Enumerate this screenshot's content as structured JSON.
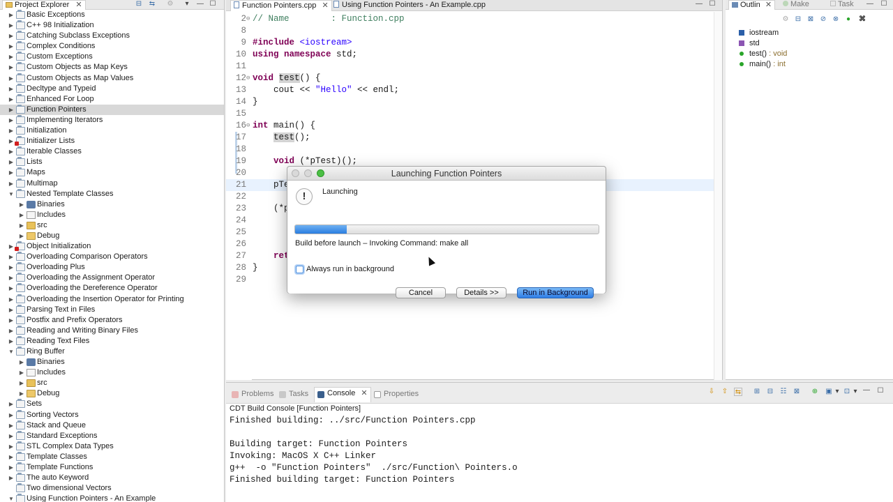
{
  "project_explorer": {
    "tab_label": "Project Explorer",
    "items": [
      {
        "label": "Basic Exceptions",
        "depth": 0,
        "expanded": false,
        "kind": "project",
        "error": false
      },
      {
        "label": "C++ 98 Initialization",
        "depth": 0,
        "expanded": false,
        "kind": "project",
        "error": false
      },
      {
        "label": "Catching Subclass Exceptions",
        "depth": 0,
        "expanded": false,
        "kind": "project",
        "error": false
      },
      {
        "label": "Complex Conditions",
        "depth": 0,
        "expanded": false,
        "kind": "project",
        "error": false
      },
      {
        "label": "Custom Exceptions",
        "depth": 0,
        "expanded": false,
        "kind": "project",
        "error": false
      },
      {
        "label": "Custom Objects as Map Keys",
        "depth": 0,
        "expanded": false,
        "kind": "project",
        "error": false
      },
      {
        "label": "Custom Objects as Map Values",
        "depth": 0,
        "expanded": false,
        "kind": "project",
        "error": false
      },
      {
        "label": "Decltype and Typeid",
        "depth": 0,
        "expanded": false,
        "kind": "project",
        "error": false
      },
      {
        "label": "Enhanced For Loop",
        "depth": 0,
        "expanded": false,
        "kind": "project",
        "error": false
      },
      {
        "label": "Function Pointers",
        "depth": 0,
        "expanded": false,
        "kind": "project",
        "error": false,
        "selected": true
      },
      {
        "label": "Implementing Iterators",
        "depth": 0,
        "expanded": false,
        "kind": "project",
        "error": false
      },
      {
        "label": "Initialization",
        "depth": 0,
        "expanded": false,
        "kind": "project",
        "error": false
      },
      {
        "label": "Initializer Lists",
        "depth": 0,
        "expanded": false,
        "kind": "project",
        "error": true
      },
      {
        "label": "Iterable Classes",
        "depth": 0,
        "expanded": false,
        "kind": "project",
        "error": false
      },
      {
        "label": "Lists",
        "depth": 0,
        "expanded": false,
        "kind": "project",
        "error": false
      },
      {
        "label": "Maps",
        "depth": 0,
        "expanded": false,
        "kind": "project",
        "error": false
      },
      {
        "label": "Multimap",
        "depth": 0,
        "expanded": false,
        "kind": "project",
        "error": false
      },
      {
        "label": "Nested Template Classes",
        "depth": 0,
        "expanded": true,
        "kind": "project",
        "error": false
      },
      {
        "label": "Binaries",
        "depth": 1,
        "expanded": false,
        "kind": "binaries",
        "error": false
      },
      {
        "label": "Includes",
        "depth": 1,
        "expanded": false,
        "kind": "includes",
        "error": false
      },
      {
        "label": "src",
        "depth": 1,
        "expanded": false,
        "kind": "src",
        "error": false
      },
      {
        "label": "Debug",
        "depth": 1,
        "expanded": false,
        "kind": "debug",
        "error": false
      },
      {
        "label": "Object Initialization",
        "depth": 0,
        "expanded": false,
        "kind": "project",
        "error": true
      },
      {
        "label": "Overloading Comparison Operators",
        "depth": 0,
        "expanded": false,
        "kind": "project",
        "error": false
      },
      {
        "label": "Overloading Plus",
        "depth": 0,
        "expanded": false,
        "kind": "project",
        "error": false
      },
      {
        "label": "Overloading the Assignment Operator",
        "depth": 0,
        "expanded": false,
        "kind": "project",
        "error": false
      },
      {
        "label": "Overloading the Dereference Operator",
        "depth": 0,
        "expanded": false,
        "kind": "project",
        "error": false
      },
      {
        "label": "Overloading the Insertion Operator for Printing",
        "depth": 0,
        "expanded": false,
        "kind": "project",
        "error": false
      },
      {
        "label": "Parsing Text in Files",
        "depth": 0,
        "expanded": false,
        "kind": "project",
        "error": false
      },
      {
        "label": "Postfix and Prefix Operators",
        "depth": 0,
        "expanded": false,
        "kind": "project",
        "error": false
      },
      {
        "label": "Reading and Writing Binary Files",
        "depth": 0,
        "expanded": false,
        "kind": "project",
        "error": false
      },
      {
        "label": "Reading Text Files",
        "depth": 0,
        "expanded": false,
        "kind": "project",
        "error": false
      },
      {
        "label": "Ring Buffer",
        "depth": 0,
        "expanded": true,
        "kind": "project",
        "error": false
      },
      {
        "label": "Binaries",
        "depth": 1,
        "expanded": false,
        "kind": "binaries",
        "error": false
      },
      {
        "label": "Includes",
        "depth": 1,
        "expanded": false,
        "kind": "includes",
        "error": false
      },
      {
        "label": "src",
        "depth": 1,
        "expanded": false,
        "kind": "src",
        "error": false
      },
      {
        "label": "Debug",
        "depth": 1,
        "expanded": false,
        "kind": "debug",
        "error": false
      },
      {
        "label": "Sets",
        "depth": 0,
        "expanded": false,
        "kind": "project",
        "error": false
      },
      {
        "label": "Sorting Vectors",
        "depth": 0,
        "expanded": false,
        "kind": "project",
        "error": false
      },
      {
        "label": "Stack and Queue",
        "depth": 0,
        "expanded": false,
        "kind": "project",
        "error": false
      },
      {
        "label": "Standard Exceptions",
        "depth": 0,
        "expanded": false,
        "kind": "project",
        "error": false
      },
      {
        "label": "STL Complex Data Types",
        "depth": 0,
        "expanded": false,
        "kind": "project",
        "error": false
      },
      {
        "label": "Template Classes",
        "depth": 0,
        "expanded": false,
        "kind": "project",
        "error": false
      },
      {
        "label": "Template Functions",
        "depth": 0,
        "expanded": false,
        "kind": "project",
        "error": false
      },
      {
        "label": "The auto Keyword",
        "depth": 0,
        "expanded": false,
        "kind": "project",
        "error": false
      },
      {
        "label": "Two dimensional Vectors",
        "depth": 0,
        "expanded": false,
        "kind": "project",
        "error": false,
        "no_twisty": true
      },
      {
        "label": "Using Function Pointers - An Example",
        "depth": 0,
        "expanded": true,
        "kind": "project",
        "error": false
      }
    ]
  },
  "editor": {
    "tabs": [
      {
        "label": "Function Pointers.cpp",
        "active": true
      },
      {
        "label": "Using Function Pointers - An Example.cpp",
        "active": false
      }
    ],
    "lines": [
      {
        "num": "2",
        "fold": "⊖",
        "html": "<span class=\"cm\">// Name        : Function.cpp</span>"
      },
      {
        "num": "8",
        "fold": "",
        "html": ""
      },
      {
        "num": "9",
        "fold": "",
        "html": "<span class=\"kw\">#include</span> <span class=\"str\">&lt;iostream&gt;</span>"
      },
      {
        "num": "10",
        "fold": "",
        "html": "<span class=\"kw\">using namespace</span> std;"
      },
      {
        "num": "11",
        "fold": "",
        "html": ""
      },
      {
        "num": "12",
        "fold": "⊖",
        "html": "<span class=\"kw\">void</span> <span class=\"mark\">test</span>() {"
      },
      {
        "num": "13",
        "fold": "",
        "html": "    cout &lt;&lt; <span class=\"str\">\"Hello\"</span> &lt;&lt; endl;"
      },
      {
        "num": "14",
        "fold": "",
        "html": "}"
      },
      {
        "num": "15",
        "fold": "",
        "html": ""
      },
      {
        "num": "16",
        "fold": "⊖",
        "html": "<span class=\"kw\">int</span> main() {"
      },
      {
        "num": "17",
        "fold": "",
        "html": "    <span class=\"mark\">test</span>();"
      },
      {
        "num": "18",
        "fold": "",
        "html": ""
      },
      {
        "num": "19",
        "fold": "",
        "html": "    <span class=\"kw\">void</span> (*pTest)();"
      },
      {
        "num": "20",
        "fold": "",
        "html": ""
      },
      {
        "num": "21",
        "fold": "",
        "html": "    pTe",
        "hl": true
      },
      {
        "num": "22",
        "fold": "",
        "html": ""
      },
      {
        "num": "23",
        "fold": "",
        "html": "    (*p"
      },
      {
        "num": "24",
        "fold": "",
        "html": ""
      },
      {
        "num": "25",
        "fold": "",
        "html": ""
      },
      {
        "num": "26",
        "fold": "",
        "html": ""
      },
      {
        "num": "27",
        "fold": "",
        "html": "    <span class=\"kw\">ret</span>"
      },
      {
        "num": "28",
        "fold": "",
        "html": "}"
      },
      {
        "num": "29",
        "fold": "",
        "html": ""
      }
    ]
  },
  "outline": {
    "tabs": [
      "Outlin",
      "Make",
      "Task"
    ],
    "items": [
      {
        "icon": "include-icon",
        "label": "iostream",
        "type": ""
      },
      {
        "icon": "namespace-icon",
        "label": "std",
        "type": ""
      },
      {
        "icon": "function-icon",
        "label": "test()",
        "type": " : void"
      },
      {
        "icon": "function-icon",
        "label": "main()",
        "type": " : int"
      }
    ]
  },
  "console": {
    "tabs": [
      {
        "label": "Problems",
        "active": false
      },
      {
        "label": "Tasks",
        "active": false
      },
      {
        "label": "Console",
        "active": true
      },
      {
        "label": "Properties",
        "active": false
      }
    ],
    "title": "CDT Build Console [Function Pointers]",
    "lines": [
      "Finished building: ../src/Function Pointers.cpp",
      "",
      "Building target: Function Pointers",
      "Invoking: MacOS X C++ Linker",
      "g++  -o \"Function Pointers\"  ./src/Function\\ Pointers.o",
      "Finished building target: Function Pointers"
    ]
  },
  "dialog": {
    "title": "Launching Function Pointers",
    "heading": "Launching",
    "progress": 0.17,
    "status": "Build before launch –  Invoking Command: make all",
    "checkbox_label": "Always run in background",
    "checkbox_checked": false,
    "cancel_label": "Cancel",
    "details_label": "Details >>",
    "run_bg_label": "Run in Background"
  },
  "colors": {
    "selection": "#d8d8d8",
    "current_line": "#e8f2fe",
    "keyword": "#7f0055",
    "string": "#2a00ff",
    "comment": "#3f7f5f",
    "primary_button": "#2f7ee6"
  }
}
